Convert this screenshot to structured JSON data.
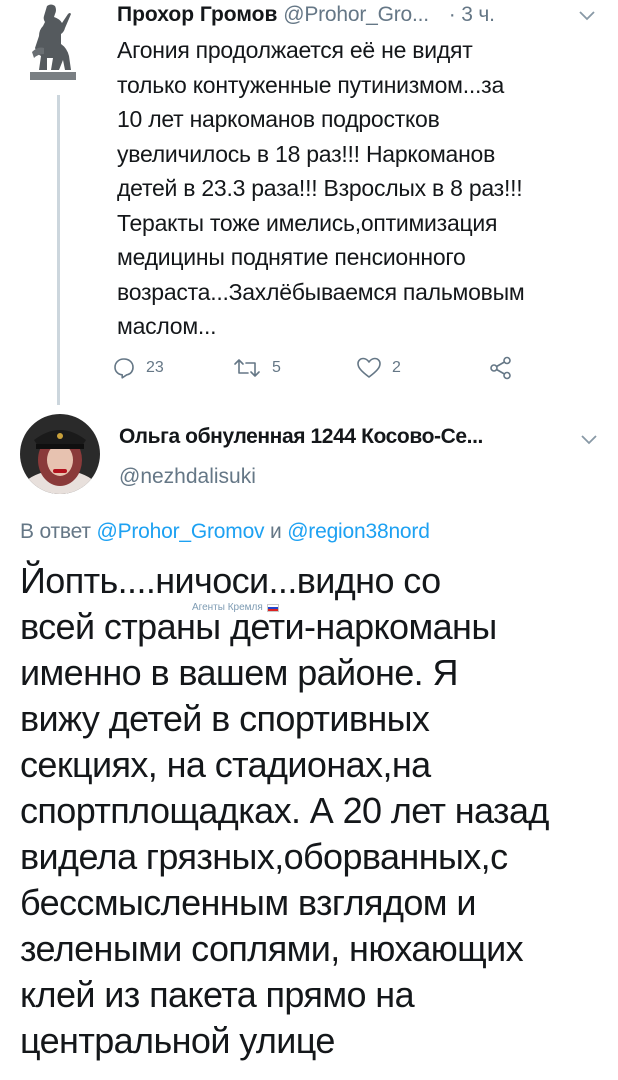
{
  "parent_tweet": {
    "author_name": "Прохор Громов",
    "author_handle": "@Prohor_Gro...",
    "time": "· 3 ч.",
    "text": "Агония продолжается её не видят\nтолько контуженные путинизмом...за\n10 лет наркоманов подростков\nувеличилось в 18 раз!!! Наркоманов\nдетей в 23.3 раза!!! Взрослых в 8 раз!!!\nТеракты тоже имелись,оптимизация\nмедицины поднятие пенсионного\nвозраста...Захлёбываемся пальмовым\nмаслом...",
    "actions": {
      "reply_count": "23",
      "retweet_count": "5",
      "like_count": "2"
    },
    "icons": [
      "avatar-statue",
      "chevron-down-icon",
      "reply-icon",
      "retweet-icon",
      "like-icon",
      "share-icon"
    ]
  },
  "reply_tweet": {
    "author_name": "Ольга обнуленная 1244 Косово-Се...",
    "author_handle": "@nezhdalisuki",
    "reply_prefix": "В ответ",
    "mention_1": "@Prohor_Gromov",
    "reply_conjunction": "и",
    "mention_2": "@region38nord",
    "text": "Йопть....ничоси...видно со\nвсей страны дети-наркоманы\nименно в вашем районе. Я\nвижу детей в спортивных\nсекциях, на стадионах,на\nспортплощадках. А 20 лет назад\nвидела грязных,оборванных,с\nбессмысленным взглядом и\nзелеными соплями, нюхающих\nклей из пакета прямо на\nцентральной улице"
  },
  "watermark": {
    "text": "Агенты Кремля"
  },
  "colors": {
    "text": "#14171a",
    "secondary": "#657786",
    "link": "#1da1f2",
    "thread_line": "#ccd6dd",
    "background": "#ffffff"
  }
}
